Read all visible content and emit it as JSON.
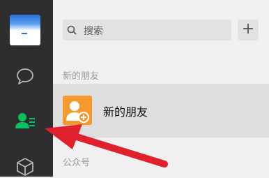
{
  "sidebar": {
    "items": [
      {
        "icon": "chat-icon"
      },
      {
        "icon": "contacts-icon",
        "active": true
      },
      {
        "icon": "cube-icon"
      }
    ]
  },
  "search": {
    "placeholder": "搜索"
  },
  "toolbar": {
    "add_label": "+"
  },
  "sections": {
    "new_friends": {
      "label": "新的朋友",
      "item_name": "新的朋友"
    },
    "official": {
      "label": "公众号"
    }
  },
  "colors": {
    "sidebar_bg": "#2e2e2e",
    "active_green": "#07c160",
    "new_friend_orange": "#f79a2d",
    "annotation_red": "#e0202a"
  }
}
